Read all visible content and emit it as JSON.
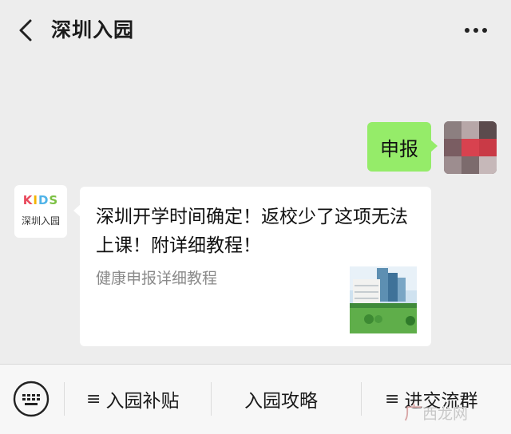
{
  "header": {
    "title": "深圳入园",
    "back_icon": "chevron-left-icon",
    "more_icon": "more-dots-icon"
  },
  "chat": {
    "sent_message": "申报",
    "kids_avatar": {
      "logo_text": "KIDS",
      "name": "深圳入园"
    },
    "card": {
      "title": "深圳开学时间确定！返校少了这项无法上课！附详细教程！",
      "description": "健康申报详细教程"
    }
  },
  "menu": {
    "keyboard_icon": "keyboard-icon",
    "items": [
      {
        "label": "入园补贴"
      },
      {
        "label": "入园攻略"
      },
      {
        "label": "进交流群"
      }
    ]
  },
  "watermark": {
    "logo": "广",
    "text": "西龙网"
  },
  "colors": {
    "background": "#ededed",
    "sent_bubble": "#95ec69",
    "card": "#ffffff",
    "desc_text": "#8a8a8a"
  }
}
